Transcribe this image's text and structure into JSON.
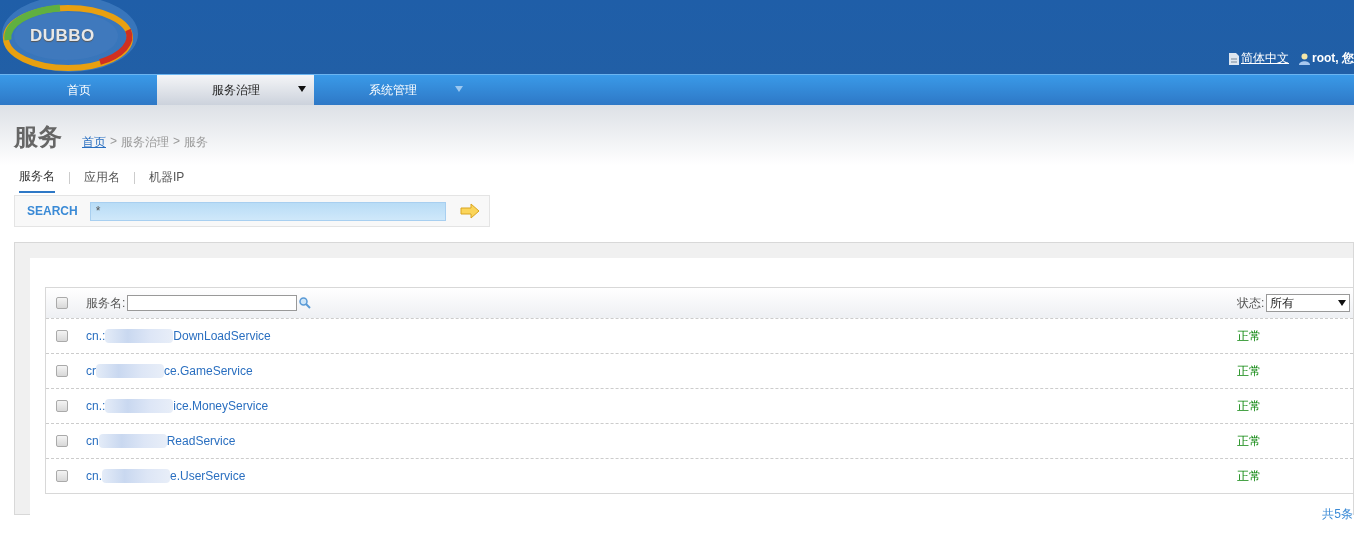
{
  "header": {
    "logo": "DUBBO",
    "language_link": "简体中文",
    "user_text": "root, 您"
  },
  "nav": [
    {
      "label": "首页",
      "selected": false,
      "has_menu": false
    },
    {
      "label": "服务治理",
      "selected": true,
      "has_menu": true
    },
    {
      "label": "系统管理",
      "selected": false,
      "has_menu": true
    }
  ],
  "page": {
    "title": "服务",
    "breadcrumb": [
      {
        "label": "首页",
        "kind": "link"
      },
      {
        "label": ">",
        "kind": "sep"
      },
      {
        "label": "服务治理",
        "kind": "text"
      },
      {
        "label": ">",
        "kind": "sep"
      },
      {
        "label": "服务",
        "kind": "text"
      }
    ]
  },
  "search_tabs": [
    {
      "label": "服务名",
      "selected": true
    },
    {
      "label": "应用名",
      "selected": false
    },
    {
      "label": "机器IP",
      "selected": false
    }
  ],
  "search": {
    "label": "SEARCH",
    "value": "*"
  },
  "table": {
    "select_all": {
      "checked": false
    },
    "name_filter_label": "服务名:",
    "status_filter_label": "状态:",
    "status_filter_value": "所有",
    "rows": [
      {
        "checked": false,
        "prefix": "cn.:",
        "suffix": "DownLoadService",
        "status": "正常"
      },
      {
        "checked": false,
        "prefix": "cr",
        "suffix": "ce.GameService",
        "status": "正常"
      },
      {
        "checked": false,
        "prefix": "cn.:",
        "suffix": "ice.MoneyService",
        "status": "正常"
      },
      {
        "checked": false,
        "prefix": "cn",
        "suffix": "ReadService",
        "status": "正常"
      },
      {
        "checked": false,
        "prefix": "cn.",
        "suffix": "e.UserService",
        "status": "正常"
      }
    ]
  },
  "footer": {
    "total": "共5条"
  }
}
